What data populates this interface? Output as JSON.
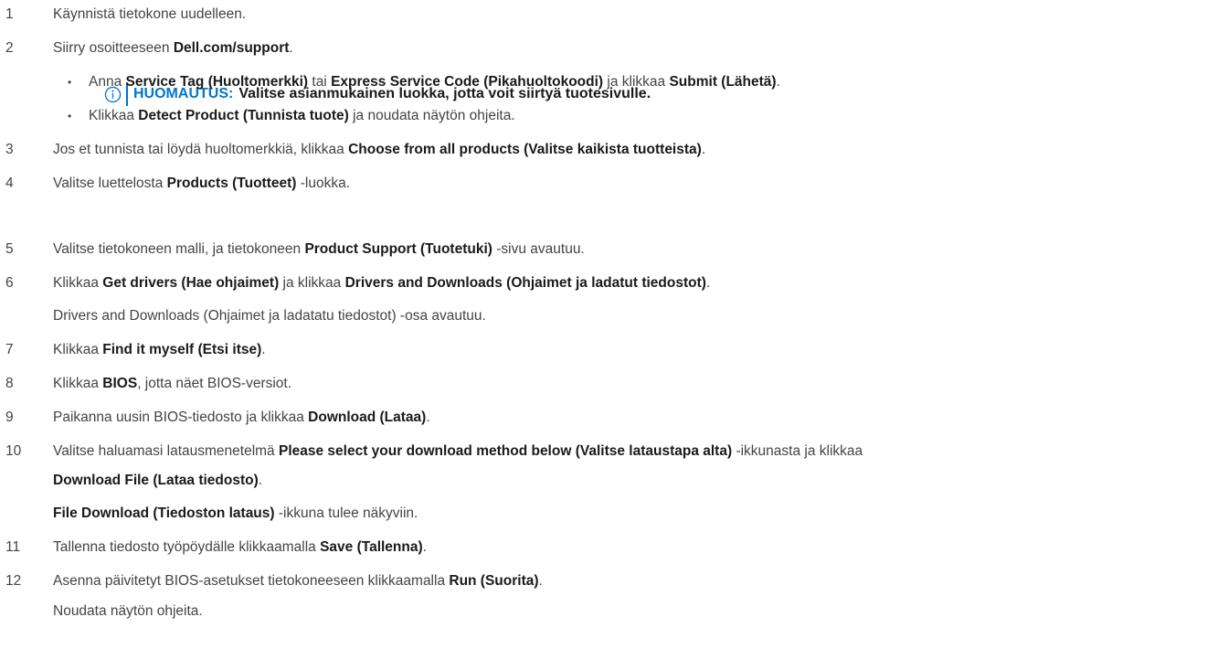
{
  "steps": [
    {
      "num": "1",
      "parts": [
        {
          "t": "Käynnistä tietokone uudelleen."
        }
      ]
    },
    {
      "num": "2",
      "parts": [
        {
          "t": "Siirry osoitteeseen "
        },
        {
          "t": "Dell.com/support",
          "b": true
        },
        {
          "t": "."
        }
      ]
    },
    {
      "bullet": "•",
      "parts": [
        {
          "t": "Anna "
        },
        {
          "t": "Service Tag (Huoltomerkki)",
          "b": true
        },
        {
          "t": " tai "
        },
        {
          "t": "Express Service Code (Pikahuoltokoodi)",
          "b": true
        },
        {
          "t": " ja klikkaa "
        },
        {
          "t": "Submit (Lähetä)",
          "b": true
        },
        {
          "t": "."
        }
      ]
    },
    {
      "bullet": "•",
      "parts": [
        {
          "t": "Klikkaa "
        },
        {
          "t": "Detect Product (Tunnista tuote)",
          "b": true
        },
        {
          "t": " ja noudata näytön ohjeita."
        }
      ]
    },
    {
      "num": "3",
      "parts": [
        {
          "t": "Jos et tunnista tai löydä huoltomerkkiä, klikkaa "
        },
        {
          "t": "Choose from all products (Valitse kaikista tuotteista)",
          "b": true
        },
        {
          "t": "."
        }
      ]
    },
    {
      "num": "4",
      "parts": [
        {
          "t": "Valitse luettelosta "
        },
        {
          "t": "Products (Tuotteet)",
          "b": true
        },
        {
          "t": " -luokka."
        }
      ]
    },
    {
      "num": "5",
      "parts": [
        {
          "t": "Valitse tietokoneen malli, ja tietokoneen "
        },
        {
          "t": "Product Support (Tuotetuki)",
          "b": true
        },
        {
          "t": " -sivu avautuu."
        }
      ]
    },
    {
      "num": "6",
      "parts": [
        {
          "t": "Klikkaa "
        },
        {
          "t": "Get drivers (Hae ohjaimet)",
          "b": true
        },
        {
          "t": " ja klikkaa "
        },
        {
          "t": "Drivers and Downloads (Ohjaimet ja ladatut tiedostot)",
          "b": true
        },
        {
          "t": "."
        }
      ]
    },
    {
      "parts": [
        {
          "t": "Drivers and Downloads (Ohjaimet ja ladatatu tiedostot) -osa avautuu."
        }
      ]
    },
    {
      "num": "7",
      "parts": [
        {
          "t": "Klikkaa "
        },
        {
          "t": "Find it myself (Etsi itse)",
          "b": true
        },
        {
          "t": "."
        }
      ]
    },
    {
      "num": "8",
      "parts": [
        {
          "t": "Klikkaa "
        },
        {
          "t": "BIOS",
          "b": true
        },
        {
          "t": ", jotta näet BIOS-versiot."
        }
      ]
    },
    {
      "num": "9",
      "parts": [
        {
          "t": "Paikanna uusin BIOS-tiedosto ja klikkaa "
        },
        {
          "t": "Download (Lataa)",
          "b": true
        },
        {
          "t": "."
        }
      ]
    },
    {
      "num": "10",
      "parts": [
        {
          "t": "Valitse haluamasi lataus­menetelmä "
        },
        {
          "t": "Please select your download method below (Valitse lataustapa alta)",
          "b": true
        },
        {
          "t": " -ikkunasta ja klikkaa"
        }
      ]
    },
    {
      "parts": [
        {
          "t": "Download File (Lataa tiedosto)",
          "b": true
        },
        {
          "t": "."
        }
      ]
    },
    {
      "parts": [
        {
          "t": "File Download (Tiedoston lataus)",
          "b": true
        },
        {
          "t": " -ikkuna tulee näkyviin."
        }
      ]
    },
    {
      "num": "11",
      "parts": [
        {
          "t": "Tallenna tiedosto työpöydälle klikkaamalla "
        },
        {
          "t": "Save (Tallenna)",
          "b": true
        },
        {
          "t": "."
        }
      ]
    },
    {
      "num": "12",
      "parts": [
        {
          "t": "Asenna päivitetyt BIOS-asetukset tietokoneeseen klikkaamalla "
        },
        {
          "t": "Run (Suorita)",
          "b": true
        },
        {
          "t": "."
        }
      ]
    },
    {
      "parts": [
        {
          "t": "Noudata näytön ohjeita."
        }
      ]
    }
  ],
  "note": {
    "icon": "info-icon",
    "label": "HUOMAUTUS:",
    "text": "Valitse asianmukainen luokka, jotta voit siirtyä tuotesivulle.",
    "accent": "#0076ce"
  }
}
